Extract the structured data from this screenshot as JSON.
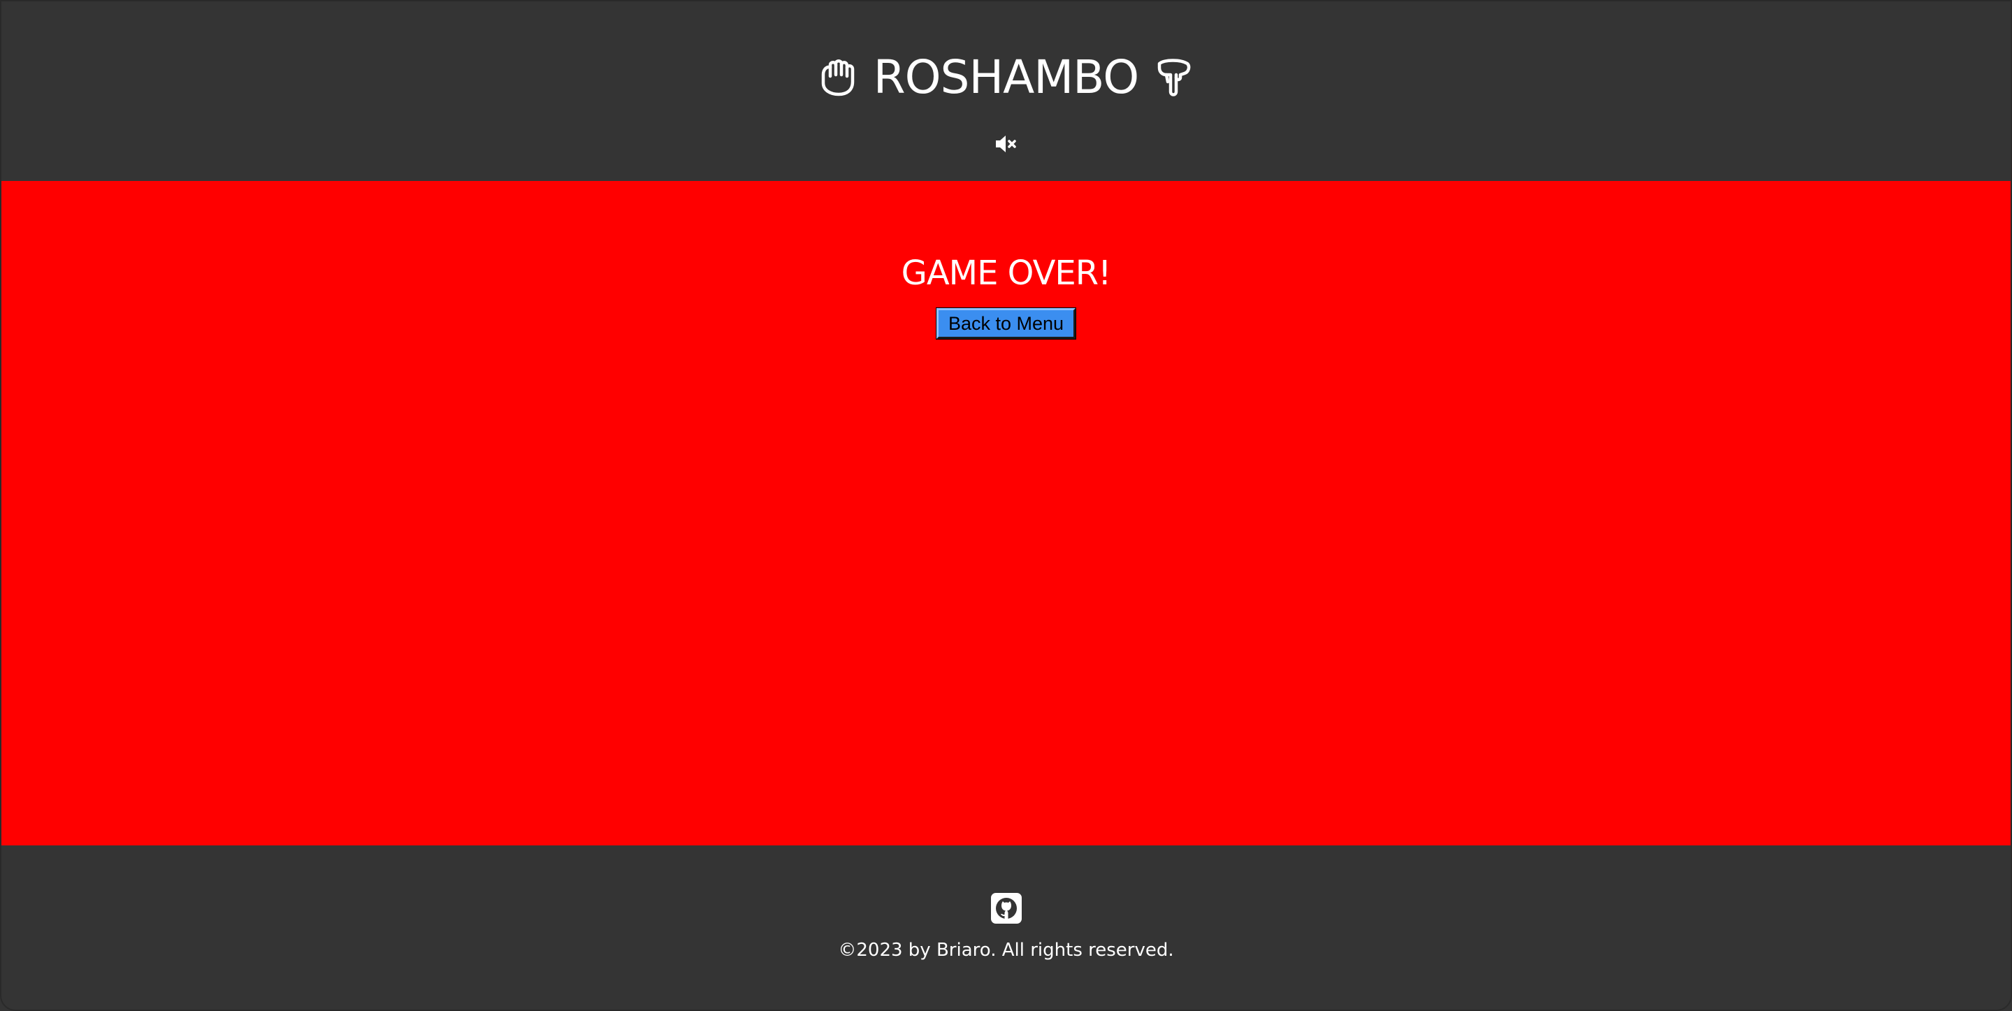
{
  "header": {
    "title": "ROSHAMBO",
    "left_icon": "fist-hand-icon",
    "right_icon": "pointing-down-hand-icon",
    "sound_icon": "speaker-muted-icon"
  },
  "main": {
    "status_text": "GAME OVER!",
    "back_button_label": "Back to Menu"
  },
  "footer": {
    "github_icon": "github-icon",
    "copyright": "©2023 by Briaro. All rights reserved."
  },
  "colors": {
    "header_bg": "#343434",
    "main_bg": "#ff0000",
    "button_bg": "#3b8ef0",
    "text": "#ffffff"
  }
}
